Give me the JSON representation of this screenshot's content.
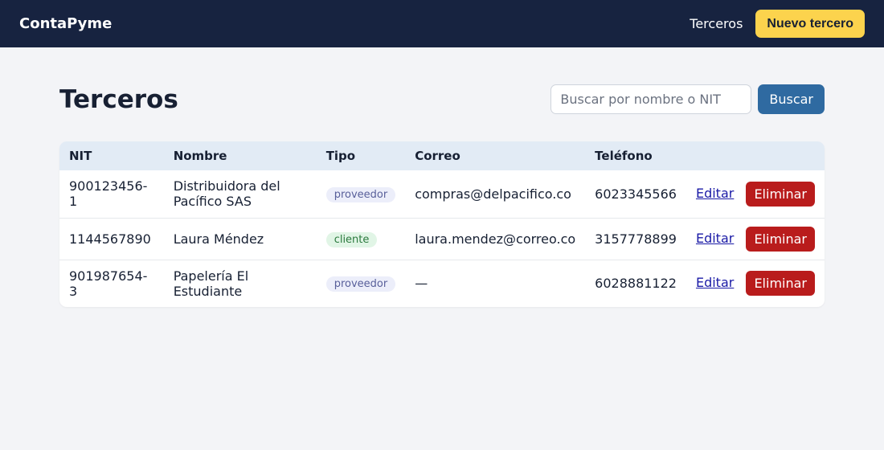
{
  "header": {
    "brand": "ContaPyme",
    "nav_link": "Terceros",
    "new_button": "Nuevo tercero"
  },
  "page": {
    "title": "Terceros",
    "search_placeholder": "Buscar por nombre o NIT",
    "search_button": "Buscar"
  },
  "table": {
    "columns": [
      "NIT",
      "Nombre",
      "Tipo",
      "Correo",
      "Teléfono"
    ],
    "rows": [
      {
        "nit": "900123456-1",
        "nombre": "Distribuidora del Pacífico SAS",
        "tipo": "proveedor",
        "correo": "compras@delpacifico.co",
        "telefono": "6023345566",
        "edit": "Editar",
        "delete": "Eliminar"
      },
      {
        "nit": "1144567890",
        "nombre": "Laura Méndez",
        "tipo": "cliente",
        "correo": "laura.mendez@correo.co",
        "telefono": "3157778899",
        "edit": "Editar",
        "delete": "Eliminar"
      },
      {
        "nit": "901987654-3",
        "nombre": "Papelería El Estudiante",
        "tipo": "proveedor",
        "correo": "—",
        "telefono": "6028881122",
        "edit": "Editar",
        "delete": "Eliminar"
      }
    ]
  },
  "colors": {
    "topbar": "#172340",
    "accent": "#fcd34d",
    "primary": "#2f6aa1",
    "danger": "#b91c1c"
  }
}
